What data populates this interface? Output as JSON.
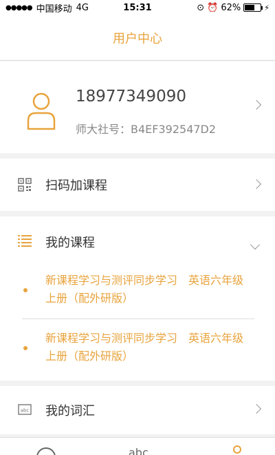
{
  "status": {
    "carrier": "中国移动",
    "network": "4G",
    "time": "15:31",
    "battery": "62%",
    "battery_level": 0.62
  },
  "header": {
    "title": "用户中心"
  },
  "profile": {
    "phone": "18977349090",
    "number_text": "师大社号：B4EF392547D2"
  },
  "menu": {
    "scan_label": "扫码加课程",
    "my_courses_label": "我的课程",
    "vocab_label": "我的词汇"
  },
  "courses": [
    {
      "title": "新课程学习与测评同步学习　英语六年级上册（配外研版）"
    },
    {
      "title": "新课程学习与测评同步学习　英语六年级上册（配外研版）"
    }
  ],
  "tabbar": {
    "abc_label": "abc"
  },
  "colors": {
    "accent": "#e8a33c"
  }
}
